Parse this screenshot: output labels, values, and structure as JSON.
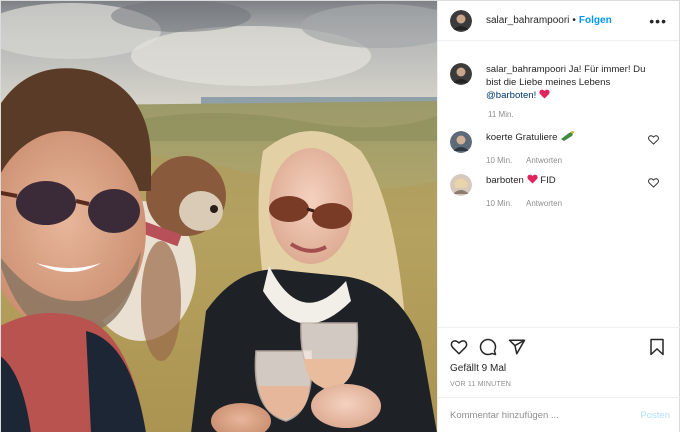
{
  "header": {
    "username": "salar_bahrampoori",
    "separator": "•",
    "follow_label": "Folgen",
    "more_label": "•••"
  },
  "caption": {
    "username": "salar_bahrampoori",
    "text": "Ja! Für immer! Du bist die Liebe meines Lebens",
    "mention": "@barboten!",
    "time": "11 Min."
  },
  "comments": [
    {
      "username": "koerte",
      "text": "Gratuliere",
      "emoji": "bottle-emoji",
      "time": "10 Min.",
      "reply_label": "Antworten"
    },
    {
      "username": "barboten",
      "text": "FID",
      "emoji": "red-heart-emoji",
      "time": "10 Min.",
      "reply_label": "Antworten"
    }
  ],
  "actions": {
    "icons": [
      "heart-icon",
      "comment-icon",
      "share-icon",
      "bookmark-icon"
    ],
    "likes": "Gefällt 9 Mal",
    "ago": "VOR 11 MINUTEN"
  },
  "add_comment": {
    "placeholder": "Kommentar hinzufügen ...",
    "post_label": "Posten"
  },
  "colors": {
    "accent": "#0095f6",
    "post_disabled": "#b2dffc",
    "mention": "#00376b",
    "heart": "#ed4956",
    "muted": "#8e8e8e"
  }
}
